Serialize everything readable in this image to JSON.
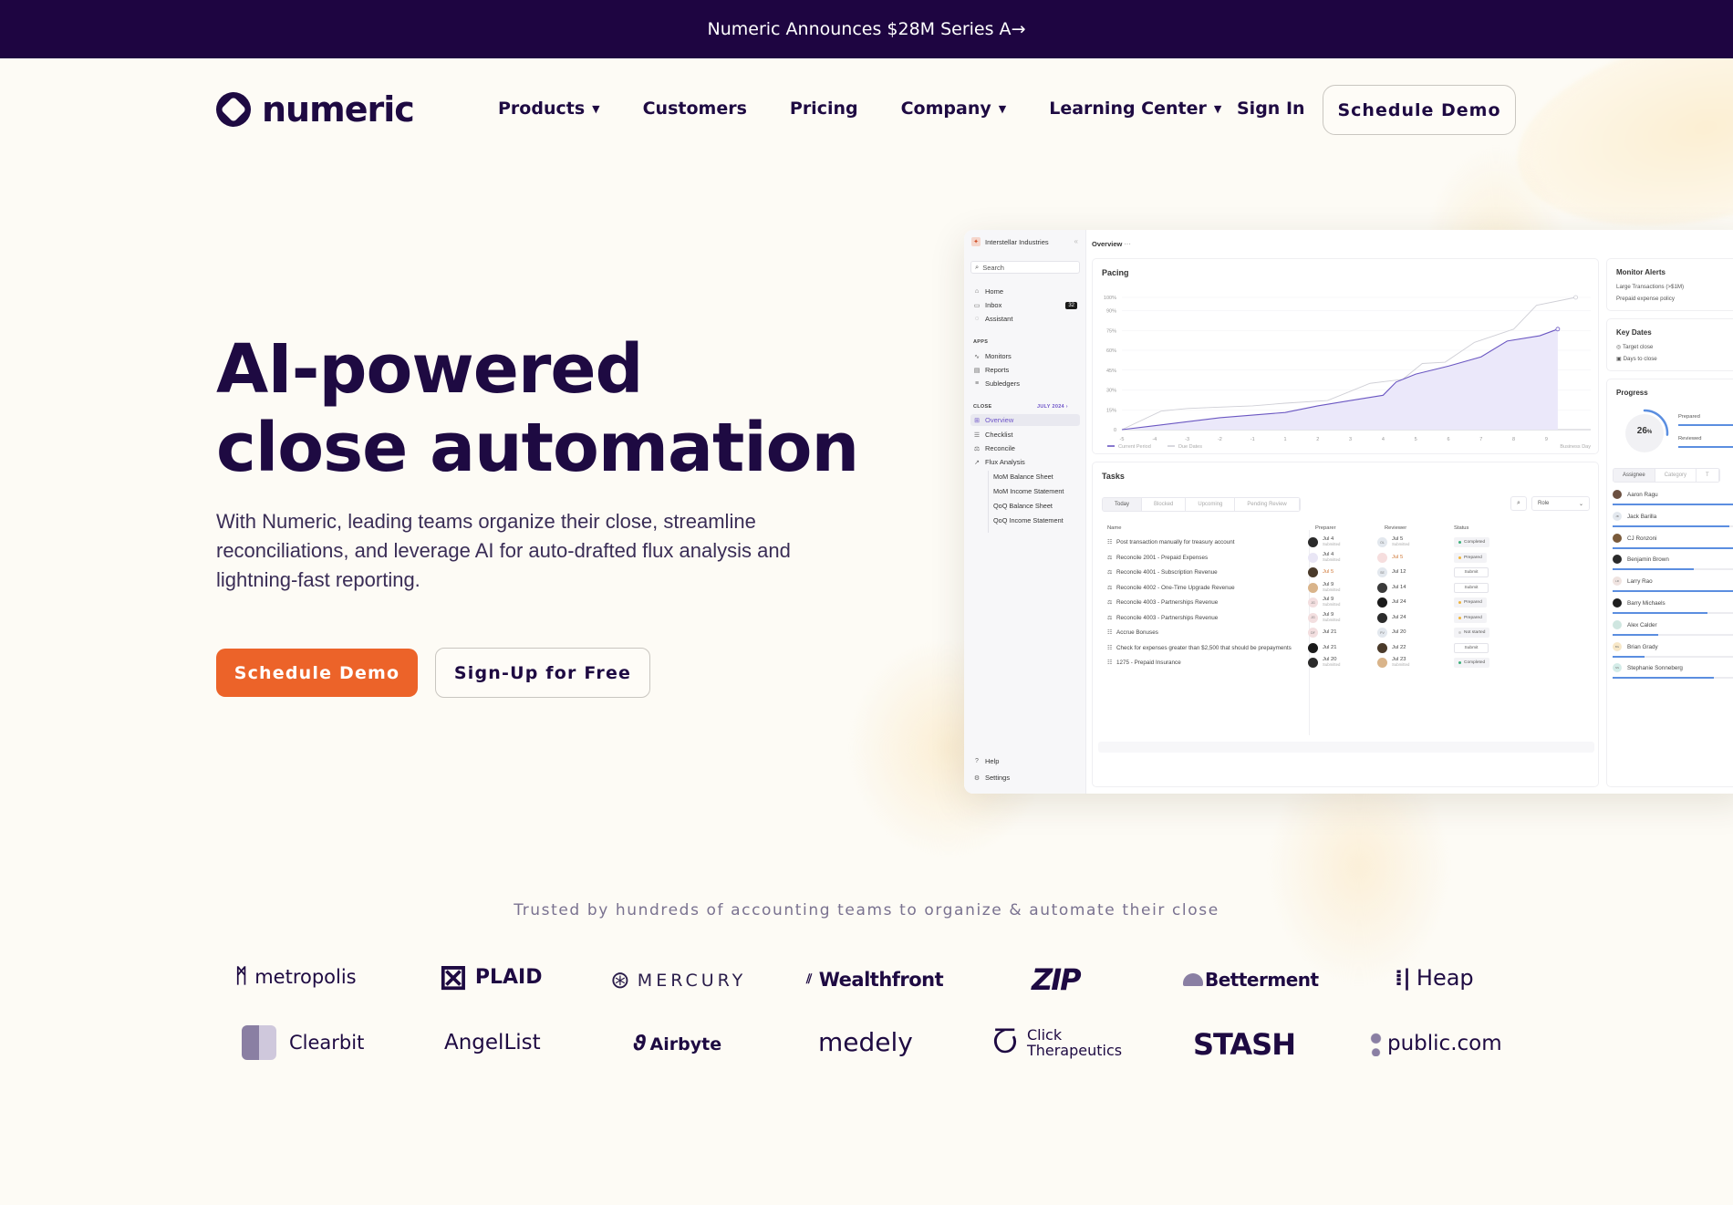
{
  "banner": {
    "text": "Numeric Announces $28M Series A",
    "arrow": "→"
  },
  "brand": {
    "name": "numeric",
    "primary_color": "#1e0541",
    "accent_color": "#ec6329"
  },
  "nav": {
    "items": [
      {
        "label": "Products",
        "dropdown": true
      },
      {
        "label": "Customers",
        "dropdown": false
      },
      {
        "label": "Pricing",
        "dropdown": false
      },
      {
        "label": "Company",
        "dropdown": true
      },
      {
        "label": "Learning Center",
        "dropdown": true
      }
    ],
    "caret": "▼",
    "sign_in": "Sign In",
    "schedule_demo": "Schedule Demo"
  },
  "hero": {
    "title_line1": "AI-powered",
    "title_line2": "close automation",
    "subtitle": "With Numeric, leading teams organize their close, streamline reconciliations, and leverage AI for auto-drafted flux analysis and lightning-fast reporting.",
    "primary_cta": "Schedule Demo",
    "secondary_cta": "Sign-Up for Free"
  },
  "app": {
    "org": "Interstellar Industries",
    "search_placeholder": "Search",
    "nav_top": [
      {
        "label": "Home",
        "icon": "⌂"
      },
      {
        "label": "Inbox",
        "icon": "▭",
        "badge": "32"
      },
      {
        "label": "Assistant",
        "icon": "◌"
      }
    ],
    "apps_heading": "APPS",
    "apps": [
      {
        "label": "Monitors",
        "icon": "∿"
      },
      {
        "label": "Reports",
        "icon": "▤"
      },
      {
        "label": "Subledgers",
        "icon": "≡"
      }
    ],
    "close_heading": "CLOSE",
    "close_period": "JULY 2024",
    "close_items": [
      {
        "label": "Overview",
        "icon": "⊞",
        "active": true
      },
      {
        "label": "Checklist",
        "icon": "☰"
      },
      {
        "label": "Reconcile",
        "icon": "⚖"
      },
      {
        "label": "Flux Analysis",
        "icon": "↗"
      }
    ],
    "flux_items": [
      "MoM Balance Sheet",
      "MoM Income Statement",
      "QoQ Balance Sheet",
      "QoQ Income Statement"
    ],
    "bottom": [
      {
        "label": "Help",
        "icon": "?"
      },
      {
        "label": "Settings",
        "icon": "⚙"
      }
    ],
    "page_title": "Overview",
    "page_more": "···",
    "pacing": {
      "title": "Pacing",
      "legend_current": "Current Period",
      "legend_due": "Due Dates",
      "x_axis_label": "Business Day"
    },
    "monitor_alerts": {
      "title": "Monitor Alerts",
      "items": [
        "Large Transactions (>$1M)",
        "Prepaid expense policy"
      ]
    },
    "key_dates": {
      "title": "Key Dates",
      "items": [
        "Target close",
        "Days to close"
      ]
    },
    "progress": {
      "title": "Progress",
      "percent": 26,
      "percent_value": "26",
      "percent_sign": "%",
      "prepared_label": "Prepared",
      "reviewed_label": "Reviewed",
      "tabs": [
        "Assignee",
        "Category",
        "T"
      ],
      "assignees": [
        {
          "name": "Aaron Ragu",
          "initials": "",
          "progress": 1.0
        },
        {
          "name": "Jack Barilla",
          "initials": "JB",
          "progress": 0.85
        },
        {
          "name": "CJ Ronzoni",
          "initials": "",
          "progress": 1.0
        },
        {
          "name": "Benjamin Brown",
          "initials": "",
          "progress": 0.59
        },
        {
          "name": "Larry Rao",
          "initials": "LR",
          "progress": 1.0
        },
        {
          "name": "Barry Michaels",
          "initials": "",
          "progress": 0.69
        },
        {
          "name": "Alex Calder",
          "initials": "",
          "progress": 0.33
        },
        {
          "name": "Brian Grady",
          "initials": "BG",
          "progress": 0.23
        },
        {
          "name": "Stephanie Sonneberg",
          "initials": "SS",
          "progress": 0.74
        }
      ]
    },
    "tasks": {
      "title": "Tasks",
      "tabs": [
        "Today",
        "Blocked",
        "Upcoming",
        "Pending Review"
      ],
      "role_label": "Role",
      "columns": [
        "Name",
        "Preparer",
        "Reviewer",
        "Status"
      ],
      "rows": [
        {
          "icon": "checklist",
          "name": "Post transaction manually for treasury account",
          "prep_date": "Jul 4",
          "prep_sub": "Submitted",
          "prep_initials": "",
          "rev_date": "Jul 5",
          "rev_sub": "Submitted",
          "rev_initials": "OL",
          "status": "Completed",
          "overdue_prep": false,
          "overdue_rev": false
        },
        {
          "icon": "reconcile",
          "name": "Reconcile 2001 - Prepaid Expenses",
          "prep_date": "Jul 4",
          "prep_sub": "Submitted",
          "prep_initials": "",
          "rev_date": "Jul 5",
          "rev_sub": "",
          "rev_initials": "",
          "status": "Prepared",
          "overdue_prep": false,
          "overdue_rev": true
        },
        {
          "icon": "reconcile",
          "name": "Reconcile 4001 - Subscription Revenue",
          "prep_date": "Jul 5",
          "prep_sub": "",
          "prep_initials": "",
          "rev_date": "Jul 12",
          "rev_sub": "",
          "rev_initials": "SE",
          "status": "Submit",
          "overdue_prep": true,
          "overdue_rev": false
        },
        {
          "icon": "reconcile",
          "name": "Reconcile 4002 - One-Time Upgrade Revenue",
          "prep_date": "Jul 9",
          "prep_sub": "Submitted",
          "prep_initials": "",
          "rev_date": "Jul 14",
          "rev_sub": "",
          "rev_initials": "",
          "status": "Submit",
          "overdue_prep": false,
          "overdue_rev": false
        },
        {
          "icon": "reconcile",
          "name": "Reconcile 4003 - Partnerships Revenue",
          "prep_date": "Jul 9",
          "prep_sub": "Submitted",
          "prep_initials": "JG",
          "rev_date": "Jul 24",
          "rev_sub": "",
          "rev_initials": "",
          "status": "Prepared",
          "overdue_prep": false,
          "overdue_rev": false
        },
        {
          "icon": "reconcile",
          "name": "Reconcile 4003 - Partnerships Revenue",
          "prep_date": "Jul 9",
          "prep_sub": "Submitted",
          "prep_initials": "JG",
          "rev_date": "Jul 24",
          "rev_sub": "",
          "rev_initials": "",
          "status": "Prepared",
          "overdue_prep": false,
          "overdue_rev": false
        },
        {
          "icon": "checklist",
          "name": "Accrue Bonuses",
          "prep_date": "Jul 21",
          "prep_sub": "",
          "prep_initials": "DF",
          "rev_date": "Jul 20",
          "rev_sub": "",
          "rev_initials": "PV",
          "status": "Not started",
          "overdue_prep": false,
          "overdue_rev": false
        },
        {
          "icon": "checklist",
          "name": "Check for expenses greater than $2,500 that should be prepayments",
          "prep_date": "Jul 21",
          "prep_sub": "",
          "prep_initials": "",
          "rev_date": "Jul 22",
          "rev_sub": "",
          "rev_initials": "",
          "status": "Submit",
          "overdue_prep": false,
          "overdue_rev": false
        },
        {
          "icon": "checklist",
          "name": "1275 - Prepaid Insurance",
          "prep_date": "Jul 20",
          "prep_sub": "Submitted",
          "prep_initials": "",
          "rev_date": "Jul 23",
          "rev_sub": "Submitted",
          "rev_initials": "",
          "status": "Completed",
          "overdue_prep": false,
          "overdue_rev": false
        }
      ]
    }
  },
  "chart_data": {
    "type": "area",
    "title": "Pacing",
    "xlabel": "Business Day",
    "ylabel": "",
    "x_ticks": [
      "-5",
      "-4",
      "-3",
      "-2",
      "-1",
      "1",
      "2",
      "3",
      "4",
      "5",
      "6",
      "7",
      "8",
      "9"
    ],
    "y_ticks": [
      "0",
      "15%",
      "30%",
      "45%",
      "60%",
      "75%",
      "90%",
      "100%"
    ],
    "y_tick_values": [
      0,
      15,
      30,
      45,
      60,
      75,
      90,
      100
    ],
    "ylim": [
      0,
      100
    ],
    "grid": true,
    "legend": "bottom-left",
    "series": [
      {
        "name": "Current Period",
        "color": "#6b57c2",
        "fill": "#ebe8fa",
        "points": [
          [
            0,
            0
          ],
          [
            1,
            3
          ],
          [
            2,
            6
          ],
          [
            3,
            9
          ],
          [
            4,
            11
          ],
          [
            5,
            13
          ],
          [
            6,
            18
          ],
          [
            7,
            22
          ],
          [
            8,
            26
          ],
          [
            8.4,
            36
          ],
          [
            9,
            42
          ],
          [
            10,
            48
          ],
          [
            11,
            55
          ],
          [
            11.8,
            67
          ],
          [
            12.8,
            71
          ],
          [
            13.35,
            76
          ]
        ]
      },
      {
        "name": "Due Dates",
        "color": "#cfcfd6",
        "points": [
          [
            0,
            0
          ],
          [
            1.2,
            14
          ],
          [
            2,
            16
          ],
          [
            3,
            17
          ],
          [
            4,
            18
          ],
          [
            5,
            20
          ],
          [
            6.3,
            22
          ],
          [
            7,
            29
          ],
          [
            7.6,
            35
          ],
          [
            8.6,
            38
          ],
          [
            9.2,
            50
          ],
          [
            9.9,
            51
          ],
          [
            10.8,
            66
          ],
          [
            12,
            76
          ],
          [
            12.7,
            94
          ],
          [
            13.9,
            100
          ]
        ]
      }
    ]
  },
  "social_proof": {
    "tagline": "Trusted by hundreds of accounting teams to organize & automate their close",
    "logos_row1": [
      "metropolis",
      "PLAID",
      "MERCURY",
      "Wealthfront",
      "ZIP",
      "Betterment",
      "Heap"
    ],
    "logos_row2": [
      "Clearbit",
      "AngelList",
      "Airbyte",
      "medely",
      "Click Therapeutics",
      "STASH",
      "public.com"
    ]
  }
}
